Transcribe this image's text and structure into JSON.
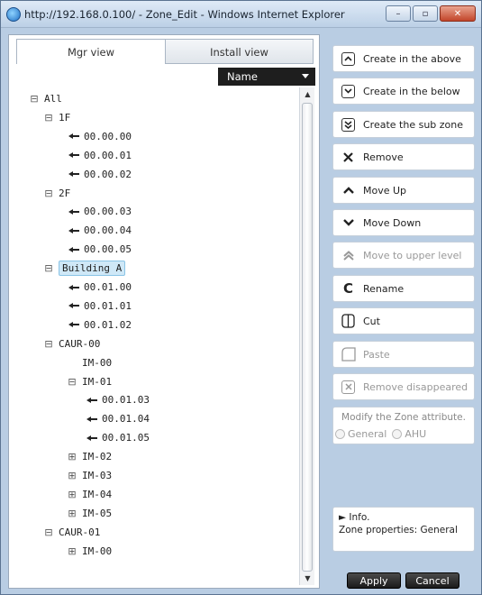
{
  "window": {
    "title": "http://192.168.0.100/ - Zone_Edit - Windows Internet Explorer",
    "minimize": "–",
    "maximize": "▫",
    "close": "✕"
  },
  "tabs": {
    "mgr": "Mgr view",
    "install": "Install view"
  },
  "sort": {
    "selected": "Name"
  },
  "tree": [
    {
      "label": "All",
      "exp": "⊟",
      "level": 0,
      "type": "group"
    },
    {
      "label": "1F",
      "exp": "⊟",
      "level": 1,
      "type": "group"
    },
    {
      "label": "00.00.00",
      "level": 2,
      "type": "leaf"
    },
    {
      "label": "00.00.01",
      "level": 2,
      "type": "leaf"
    },
    {
      "label": "00.00.02",
      "level": 2,
      "type": "leaf"
    },
    {
      "label": "2F",
      "exp": "⊟",
      "level": 1,
      "type": "group"
    },
    {
      "label": "00.00.03",
      "level": 2,
      "type": "leaf"
    },
    {
      "label": "00.00.04",
      "level": 2,
      "type": "leaf"
    },
    {
      "label": "00.00.05",
      "level": 2,
      "type": "leaf"
    },
    {
      "label": "Building A",
      "exp": "⊟",
      "level": 1,
      "type": "group",
      "selected": true
    },
    {
      "label": "00.01.00",
      "level": 2,
      "type": "leaf"
    },
    {
      "label": "00.01.01",
      "level": 2,
      "type": "leaf"
    },
    {
      "label": "00.01.02",
      "level": 2,
      "type": "leaf"
    },
    {
      "label": "CAUR-00",
      "exp": "⊟",
      "level": 1,
      "type": "group"
    },
    {
      "label": "IM-00",
      "level": 2,
      "type": "group"
    },
    {
      "label": "IM-01",
      "exp": "⊟",
      "level": 2,
      "type": "group"
    },
    {
      "label": "00.01.03",
      "level": 3,
      "type": "leaf"
    },
    {
      "label": "00.01.04",
      "level": 3,
      "type": "leaf"
    },
    {
      "label": "00.01.05",
      "level": 3,
      "type": "leaf"
    },
    {
      "label": "IM-02",
      "exp": "⊞",
      "level": 2,
      "type": "group"
    },
    {
      "label": "IM-03",
      "exp": "⊞",
      "level": 2,
      "type": "group"
    },
    {
      "label": "IM-04",
      "exp": "⊞",
      "level": 2,
      "type": "group"
    },
    {
      "label": "IM-05",
      "exp": "⊞",
      "level": 2,
      "type": "group"
    },
    {
      "label": "CAUR-01",
      "exp": "⊟",
      "level": 1,
      "type": "group"
    },
    {
      "label": "IM-00",
      "exp": "⊞",
      "level": 2,
      "type": "group"
    }
  ],
  "actions": {
    "create_above": "Create in the above",
    "create_below": "Create in the below",
    "create_sub": "Create the sub zone",
    "remove": "Remove",
    "move_up": "Move Up",
    "move_down": "Move Down",
    "move_upper": "Move to upper level",
    "rename": "Rename",
    "cut": "Cut",
    "paste": "Paste",
    "remove_disappeared": "Remove disappeared"
  },
  "attribute": {
    "title": "Modify the Zone attribute.",
    "general": "General",
    "ahu": "AHU"
  },
  "info": {
    "header": "► Info.",
    "properties": "Zone properties: General"
  },
  "footer": {
    "apply": "Apply",
    "cancel": "Cancel"
  }
}
